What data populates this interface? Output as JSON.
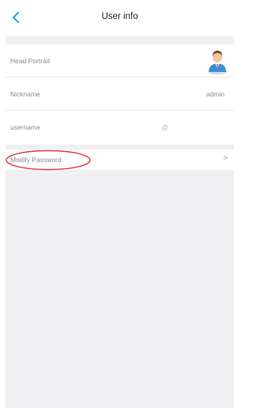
{
  "header": {
    "title": "User info",
    "back_icon": "chevron-left-icon"
  },
  "profile": {
    "head_portrait_label": "Head Portrait",
    "avatar_icon": "user-avatar-icon",
    "nickname_label": "Nickname",
    "nickname_value": "admin",
    "username_label": "username",
    "username_value": "@"
  },
  "security": {
    "modify_password_label": "Modify Password",
    "chevron": ">"
  },
  "colors": {
    "accent": "#29a8e0",
    "highlight": "#e23a3a",
    "background": "#f0f0f2"
  }
}
